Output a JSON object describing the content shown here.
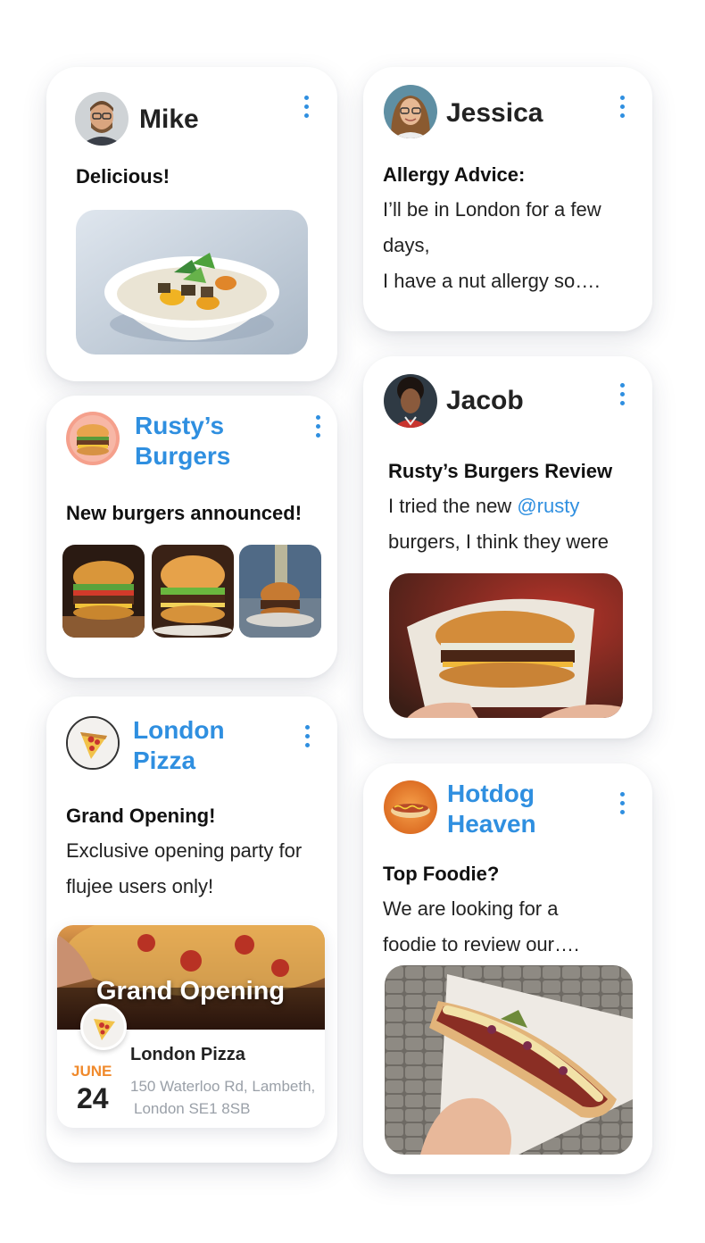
{
  "posts": {
    "mike": {
      "author": "Mike",
      "headline": "Delicious!",
      "avatar_icon": "user-avatar-photo",
      "image_icon": "noodle-bowl-photo"
    },
    "jessica": {
      "author": "Jessica",
      "headline": "Allergy Advice:",
      "body_lines": [
        "I’ll be in London for a few",
        "days,",
        "I have a nut allergy so…."
      ],
      "avatar_icon": "user-avatar-photo"
    },
    "rustys": {
      "author_line1": "Rusty’s",
      "author_line2": "Burgers",
      "headline": "New burgers announced!",
      "avatar_icon": "burger-logo",
      "image_icons": [
        "burger-photo",
        "burger-photo",
        "burger-photo"
      ]
    },
    "jacob": {
      "author": "Jacob",
      "headline": "Rusty’s Burgers Review",
      "body_line1_prefix": "I tried the new ",
      "body_line1_mention": "@rusty",
      "body_line2": "burgers, I think they were",
      "avatar_icon": "user-avatar-photo",
      "image_icon": "burger-in-hand-photo"
    },
    "london_pizza": {
      "author_line1": "London",
      "author_line2": "Pizza",
      "headline": "Grand Opening!",
      "body_lines": [
        "Exclusive opening party for",
        "flujee users only!"
      ],
      "avatar_icon": "pizza-logo",
      "event": {
        "banner_title": "Grand Opening",
        "month": "JUNE",
        "day": "24",
        "venue": "London Pizza",
        "address_line1": "150 Waterloo Rd, Lambeth,",
        "address_line2": "London SE1 8SB"
      }
    },
    "hotdog": {
      "author_line1": "Hotdog",
      "author_line2": "Heaven",
      "headline": "Top Foodie?",
      "body_lines": [
        "We are looking for a",
        "foodie to review our…."
      ],
      "avatar_icon": "hotdog-logo",
      "image_icon": "hotdog-in-hand-photo"
    }
  },
  "colors": {
    "accent": "#2f8fe0",
    "event_month": "#f08a2c",
    "address": "#9aa0a8"
  }
}
